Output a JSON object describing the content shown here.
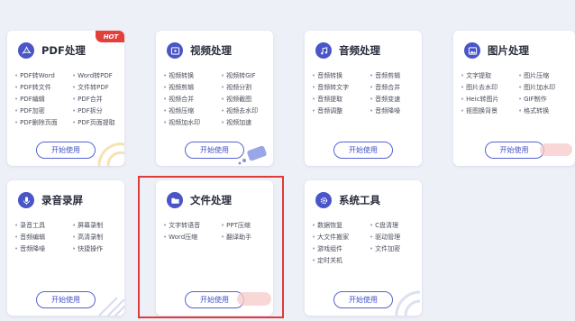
{
  "cards": [
    {
      "key": "pdf",
      "title": "PDF处理",
      "icon": "pdf-icon",
      "badge": "HOT",
      "items": [
        "PDF转Word",
        "Word转PDF",
        "PDF转文件",
        "文件转PDF",
        "PDF编辑",
        "PDF合并",
        "PDF加密",
        "PDF拆分",
        "PDF删除页面",
        "PDF页面提取"
      ],
      "button": "开始使用"
    },
    {
      "key": "video",
      "title": "视频处理",
      "icon": "play-icon",
      "items": [
        "视频转换",
        "视频转GIF",
        "视频剪辑",
        "视频分割",
        "视频合并",
        "视频截图",
        "视频压缩",
        "视频去水印",
        "视频加水印",
        "视频加速"
      ],
      "button": "开始使用"
    },
    {
      "key": "audio",
      "title": "音频处理",
      "icon": "music-note-icon",
      "items": [
        "音频转换",
        "音频剪辑",
        "音频转文字",
        "音频合并",
        "音频提取",
        "音频变速",
        "音频调整",
        "音频降噪"
      ],
      "button": "开始使用"
    },
    {
      "key": "image",
      "title": "图片处理",
      "icon": "image-icon",
      "items": [
        "文字提取",
        "图片压缩",
        "图片去水印",
        "图片加水印",
        "Heic转图片",
        "GIF制作",
        "抠图换背景",
        "格式转换"
      ],
      "button": "开始使用"
    },
    {
      "key": "record",
      "title": "录音录屏",
      "icon": "microphone-icon",
      "items": [
        "录音工具",
        "屏幕录制",
        "音频编辑",
        "高清录制",
        "音频降噪",
        "快捷操作"
      ],
      "button": "开始使用"
    },
    {
      "key": "file",
      "title": "文件处理",
      "icon": "folder-icon",
      "items": [
        "文字转语音",
        "PPT压缩",
        "Word压缩",
        "翻译助手"
      ],
      "button": "开始使用"
    },
    {
      "key": "system",
      "title": "系统工具",
      "icon": "gear-icon",
      "items": [
        "数据恢复",
        "C盘清理",
        "大文件搬家",
        "驱动管理",
        "游戏组件",
        "文件加密",
        "定时关机"
      ],
      "button": "开始使用"
    }
  ],
  "colors": {
    "accent": "#4a55c8",
    "hot_badge": "#e4403a",
    "selection_border": "#e03a3a"
  }
}
